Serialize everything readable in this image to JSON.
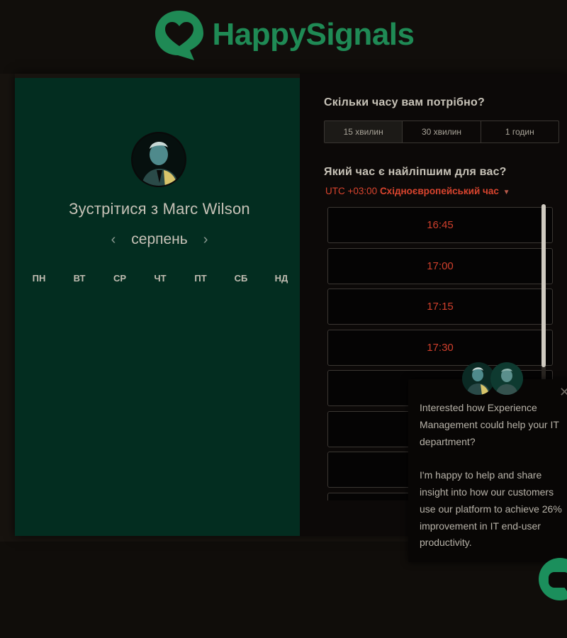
{
  "brand": {
    "name": "HappySignals",
    "color": "#1f8a55"
  },
  "scheduler": {
    "meet_title": "Зустрітися з Marc Wilson",
    "calendar": {
      "month": "серпень",
      "prev_icon": "chevron-left-icon",
      "next_icon": "chevron-right-icon",
      "weekdays": [
        "ПН",
        "ВТ",
        "СР",
        "ЧТ",
        "ПТ",
        "СБ",
        "НД"
      ]
    },
    "duration": {
      "question": "Скільки часу вам потрібно?",
      "options": [
        "15 хвилин",
        "30 хвилин",
        "1 годин"
      ],
      "selected": "15 хвилин"
    },
    "time": {
      "question": "Який час є найліпшим для вас?",
      "timezone_offset": "UTC +03:00",
      "timezone_name": "Східноєвропейський час",
      "slots": [
        "16:45",
        "17:00",
        "17:15",
        "17:30",
        "",
        "",
        "",
        ""
      ]
    },
    "colors": {
      "left_panel": "#032d20",
      "accent": "#cf3f2c"
    }
  },
  "chat": {
    "message_1": "Interested how Experience Management could help your IT department?",
    "message_2": "I'm happy to help and share insight into how our customers use our platform to achieve 26% improvement in IT end-user productivity.",
    "close_icon": "close-icon",
    "launcher_icon": "chat-bubble-icon"
  }
}
